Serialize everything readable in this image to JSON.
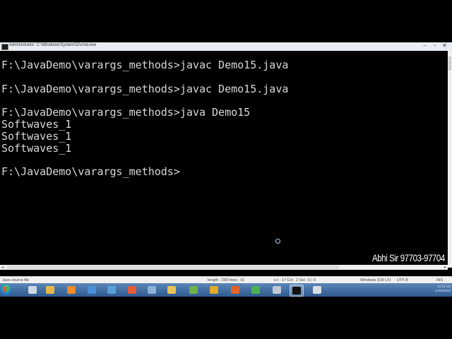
{
  "window": {
    "title": "Administrator: C:\\Windows\\System32\\cmd.exe",
    "buttons": {
      "minimize": "–",
      "maximize": "▫",
      "close": "✕"
    }
  },
  "console": {
    "lines": [
      "F:\\JavaDemo\\varargs_methods>javac Demo15.java",
      "",
      "F:\\JavaDemo\\varargs_methods>javac Demo15.java",
      "",
      "F:\\JavaDemo\\varargs_methods>java Demo15",
      "Softwaves_1",
      "Softwaves_1",
      "Softwaves_1",
      "",
      "F:\\JavaDemo\\varargs_methods>"
    ]
  },
  "watermark": "Abhi Sir 97703-97704",
  "statusbar": {
    "file_type": "Java source file",
    "length": "length : 299   lines : 31",
    "position": "Ln : 17   Col : 2   Sel : 0 | 0",
    "eol": "Windows (CR LF)",
    "encoding": "UTF-8",
    "mode": "INS"
  },
  "taskbar": {
    "icons": [
      {
        "name": "start-orb-icon",
        "color": "#1e6fd1"
      },
      {
        "name": "calculator-icon",
        "color": "#cfd8e6"
      },
      {
        "name": "folder-icon",
        "color": "#e6b84b"
      },
      {
        "name": "media-player-icon",
        "color": "#f28b2a"
      },
      {
        "name": "monitor-icon",
        "color": "#4a90d9"
      },
      {
        "name": "network-icon",
        "color": "#5aa0d8"
      },
      {
        "name": "office-icon",
        "color": "#e25b3a"
      },
      {
        "name": "window-icon",
        "color": "#8fb2d8"
      },
      {
        "name": "explorer-icon",
        "color": "#e8c25a"
      },
      {
        "name": "paint-icon",
        "color": "#6cb34a"
      },
      {
        "name": "chrome-icon",
        "color": "#e2a92a"
      },
      {
        "name": "firefox-icon",
        "color": "#e0632a"
      },
      {
        "name": "apps-icon",
        "color": "#4db24d"
      },
      {
        "name": "tools-icon",
        "color": "#c0c8d4"
      },
      {
        "name": "cmd-icon",
        "color": "#111111"
      },
      {
        "name": "display-icon",
        "color": "#d8dde6"
      },
      {
        "name": "notepad-plus-icon",
        "color": "#7bc34a"
      }
    ],
    "tray": [
      "12:23 AM",
      "11/06/2019"
    ]
  }
}
